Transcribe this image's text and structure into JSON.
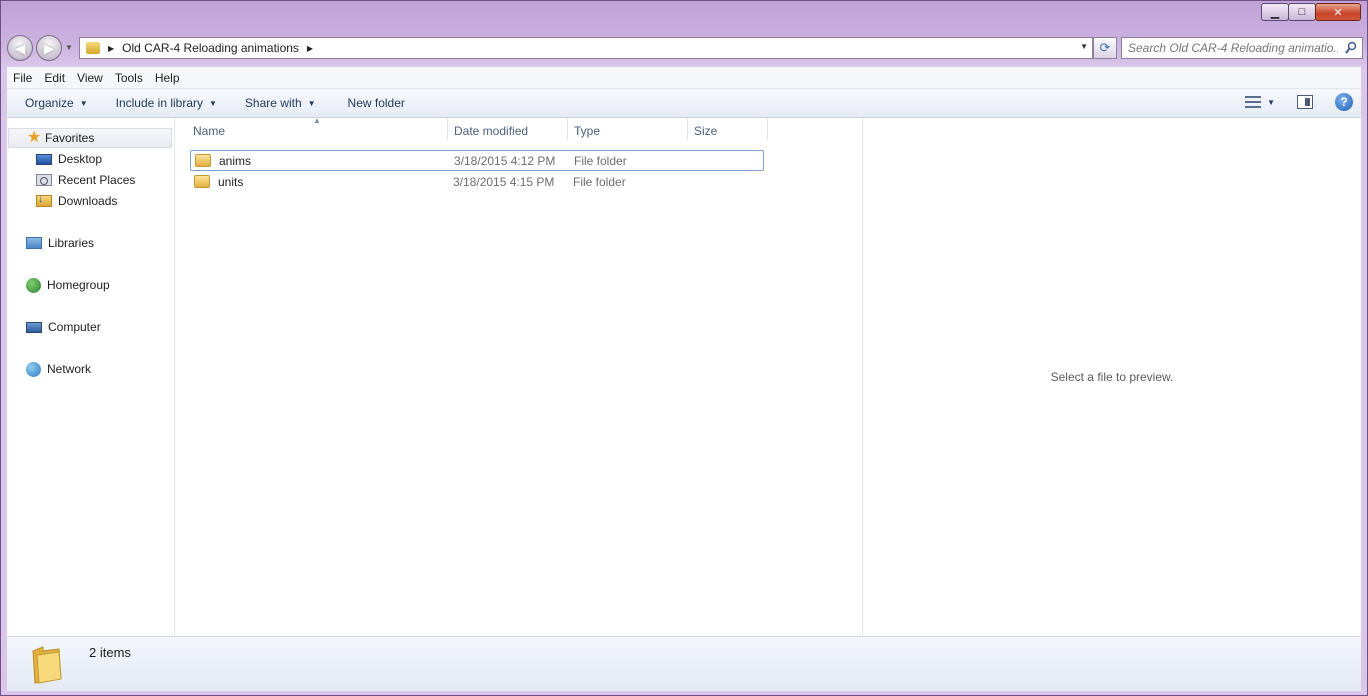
{
  "window": {
    "minimize_glyph": "▁",
    "maximize_glyph": "□",
    "close_glyph": "✕"
  },
  "address_bar": {
    "path_segments": [
      "Old CAR-4 Reloading animations"
    ],
    "back_glyph": "◀",
    "forward_glyph": "▶"
  },
  "search": {
    "placeholder": "Search Old CAR-4 Reloading animatio..."
  },
  "menubar": {
    "items": [
      "File",
      "Edit",
      "View",
      "Tools",
      "Help"
    ]
  },
  "commandbar": {
    "organize": "Organize",
    "include_in_library": "Include in library",
    "share_with": "Share with",
    "new_folder": "New folder"
  },
  "navpane": {
    "favorites": "Favorites",
    "favorites_items": [
      "Desktop",
      "Recent Places",
      "Downloads"
    ],
    "libraries": "Libraries",
    "homegroup": "Homegroup",
    "computer": "Computer",
    "network": "Network"
  },
  "filelist": {
    "columns": {
      "name": "Name",
      "date_modified": "Date modified",
      "type": "Type",
      "size": "Size"
    },
    "rows": [
      {
        "name": "anims",
        "date": "3/18/2015 4:12 PM",
        "type": "File folder"
      },
      {
        "name": "units",
        "date": "3/18/2015 4:15 PM",
        "type": "File folder"
      }
    ]
  },
  "preview": {
    "message": "Select a file to preview."
  },
  "details": {
    "count": "2 items"
  },
  "colors": {
    "glass": "#c7a8d8",
    "selection_border": "#7da2ce",
    "header_text": "#4c607a",
    "link_text": "#1e395b"
  }
}
